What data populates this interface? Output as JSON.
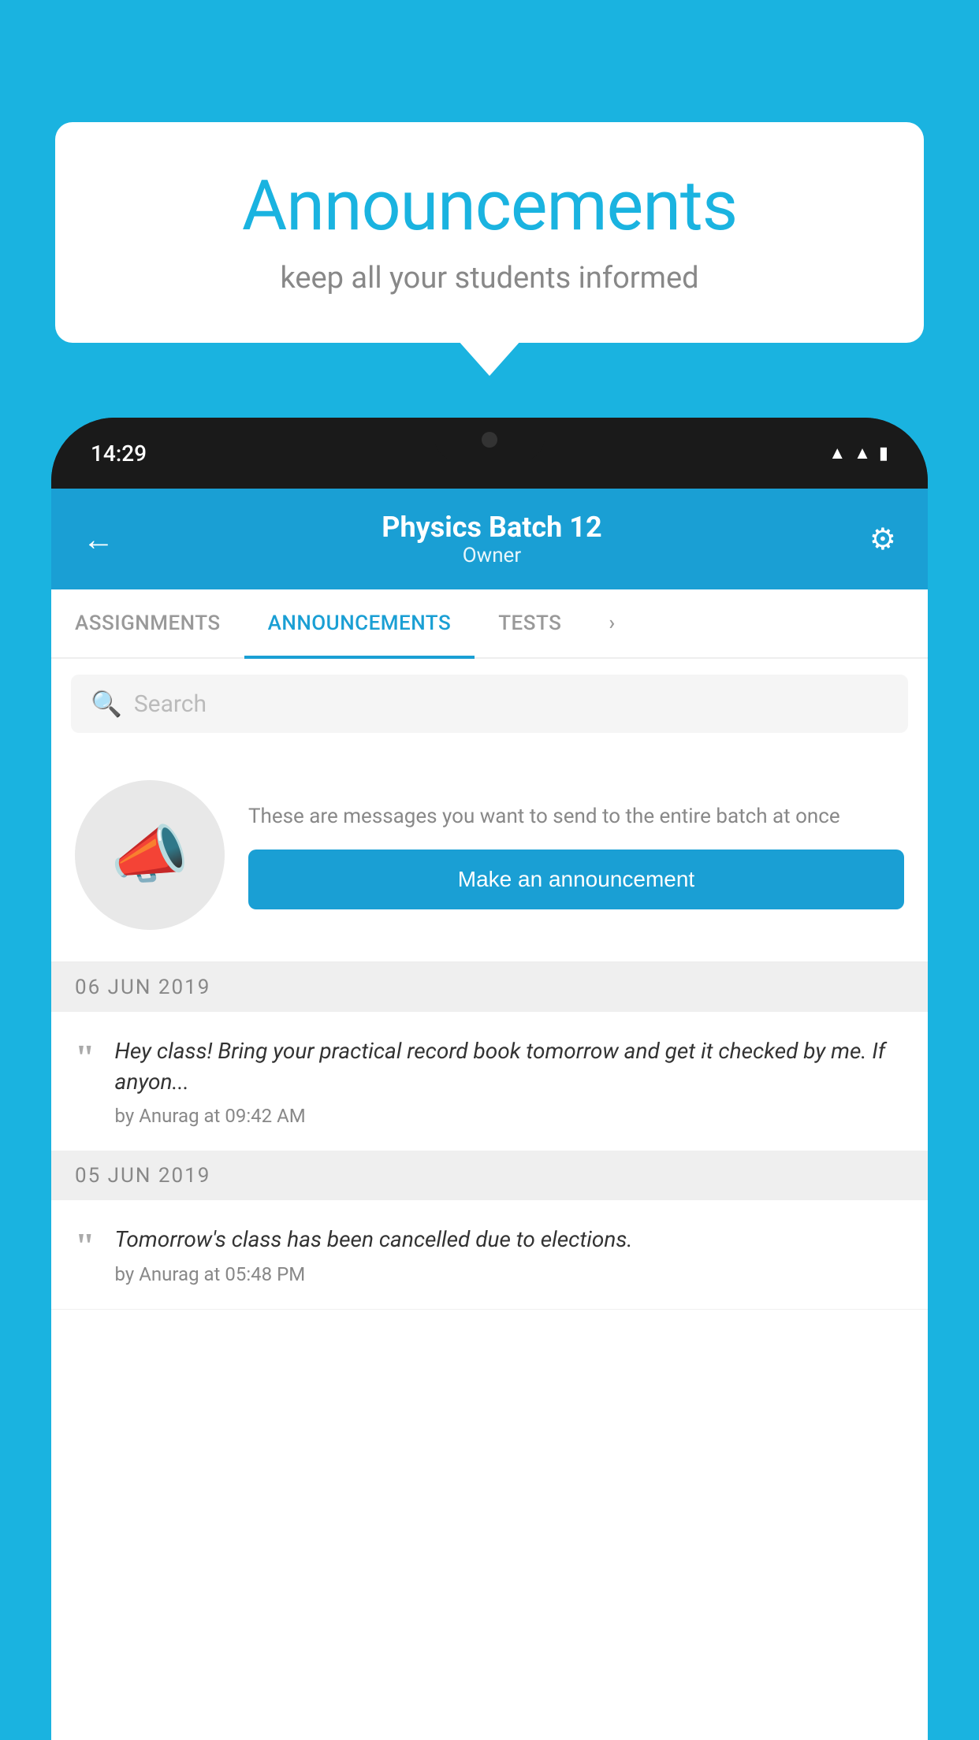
{
  "bubble": {
    "title": "Announcements",
    "subtitle": "keep all your students informed"
  },
  "status_bar": {
    "time": "14:29"
  },
  "app_bar": {
    "title": "Physics Batch 12",
    "subtitle": "Owner"
  },
  "tabs": [
    {
      "label": "ASSIGNMENTS",
      "active": false
    },
    {
      "label": "ANNOUNCEMENTS",
      "active": true
    },
    {
      "label": "TESTS",
      "active": false
    },
    {
      "label": "",
      "active": false
    }
  ],
  "search": {
    "placeholder": "Search"
  },
  "cta": {
    "description": "These are messages you want to send to the entire batch at once",
    "button_label": "Make an announcement"
  },
  "announcements": [
    {
      "date": "06  JUN  2019",
      "text": "Hey class! Bring your practical record book tomorrow and get it checked by me. If anyon...",
      "meta": "by Anurag at 09:42 AM"
    },
    {
      "date": "05  JUN  2019",
      "text": "Tomorrow's class has been cancelled due to elections.",
      "meta": "by Anurag at 05:48 PM"
    }
  ],
  "icons": {
    "back": "←",
    "gear": "⚙",
    "search": "🔍",
    "megaphone": "📣"
  },
  "colors": {
    "primary": "#1a9fd4",
    "background": "#1ab3e0",
    "tab_active": "#1a9fd4",
    "tab_inactive": "#999"
  }
}
